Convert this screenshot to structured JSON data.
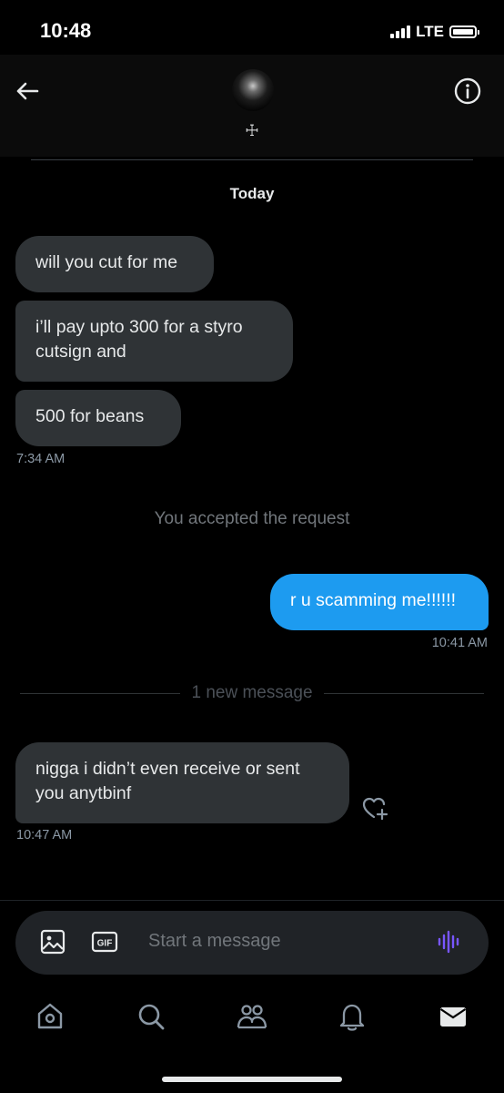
{
  "status": {
    "time": "10:48",
    "network": "LTE"
  },
  "header": {
    "name": "☩"
  },
  "conversation": {
    "date_label": "Today",
    "incoming_1": [
      "will you cut for me",
      "i’ll pay upto 300 for a styro cutsign and",
      "500 for beans"
    ],
    "incoming_1_time": "7:34 AM",
    "system_note": "You accepted the request",
    "outgoing_1": "r u scamming me!!!!!!",
    "outgoing_1_time": "10:41 AM",
    "new_message_divider": "1 new message",
    "incoming_2": "nigga i didn’t even receive or sent you anytbinf",
    "incoming_2_time": "10:47 AM"
  },
  "composer": {
    "placeholder": "Start a message",
    "gif_label": "GIF"
  },
  "tabs": [
    "home-icon",
    "search-icon",
    "communities-icon",
    "notifications-icon",
    "messages-icon"
  ],
  "colors": {
    "accent": "#1d9bf0",
    "voice": "#7856ff",
    "bubble_in": "#2f3336"
  }
}
